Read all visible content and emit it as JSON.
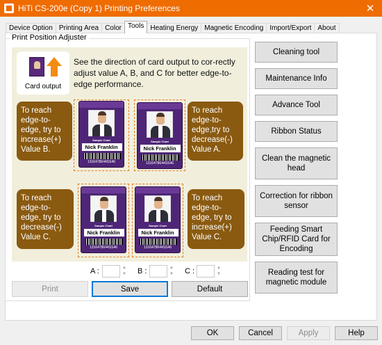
{
  "window": {
    "title": "HiTi CS-200e (Copy 1) Printing Preferences",
    "close_glyph": "✕"
  },
  "tabs": [
    {
      "label": "Device Option"
    },
    {
      "label": "Printing Area"
    },
    {
      "label": "Color"
    },
    {
      "label": "Tools",
      "active": true
    },
    {
      "label": "Heating Energy"
    },
    {
      "label": "Magnetic Encoding"
    },
    {
      "label": "Import/Export"
    },
    {
      "label": "About"
    }
  ],
  "adjuster": {
    "group_title": "Print Position Adjuster",
    "card_output_label": "Card output",
    "intro": "See the direction of card output to cor-rectly adjust value A, B, and C for better edge-to-edge performance.",
    "bubbles": [
      "To reach edge-to-edge, try to increase(+) Value B.",
      "To reach edge-to-edge,try to decrease(-) Value A.",
      "To reach edge-to-edge, try to decrease(-) Value C.",
      "To reach edge-to-edge, try to increase(+) Value C."
    ],
    "card": {
      "sample_text": "Sample Chart",
      "name": "Nick Franklin",
      "code": "1316478644SS46"
    },
    "fields": {
      "a_label": "A :",
      "b_label": "B :",
      "c_label": "C :",
      "a_value": "",
      "b_value": "",
      "c_value": ""
    },
    "buttons": {
      "print": "Print",
      "save": "Save",
      "default": "Default"
    }
  },
  "side_buttons": [
    "Cleaning tool",
    "Maintenance Info",
    "Advance Tool",
    "Ribbon Status",
    "Clean the magnetic head",
    "Correction for ribbon sensor",
    "Feeding Smart Chip/RFID Card for Encoding",
    "Reading test for magnetic module"
  ],
  "footer": {
    "ok": "OK",
    "cancel": "Cancel",
    "apply": "Apply",
    "help": "Help"
  },
  "colors": {
    "titlebar": "#ef6c00",
    "bubble": "#8a5a10",
    "card": "#4e2577",
    "focus": "#0078d7"
  },
  "icons": {
    "app": "printer-app-icon",
    "close": "close-icon",
    "card_output": "card-output-icon",
    "spin": "spin-arrows-icon"
  }
}
